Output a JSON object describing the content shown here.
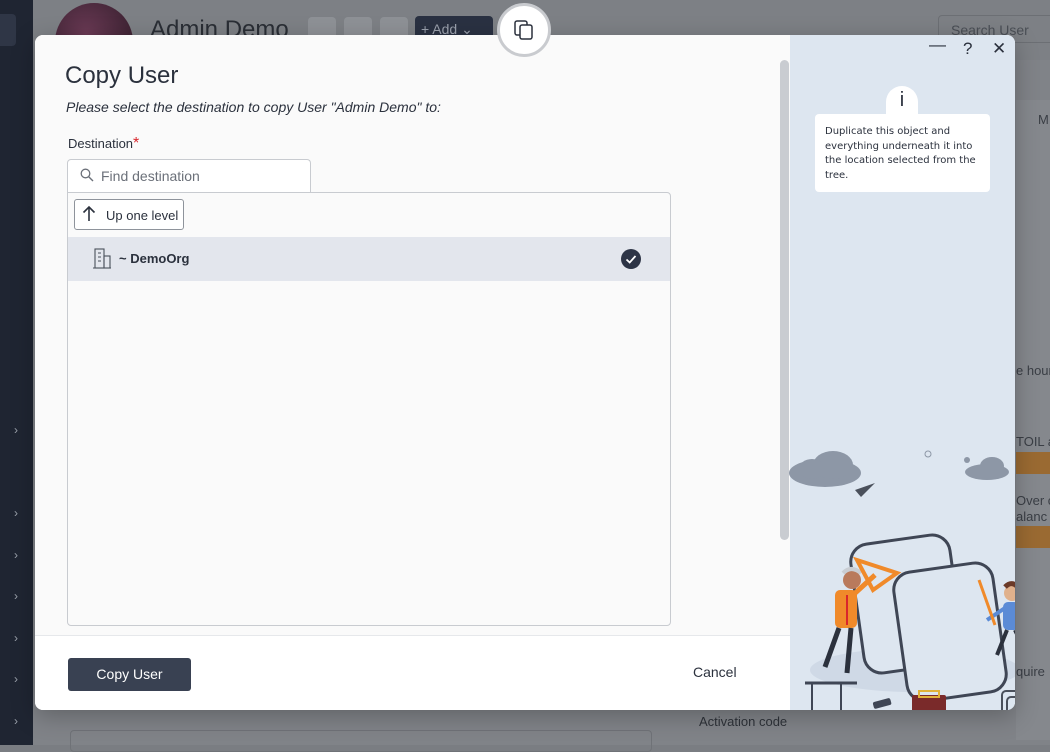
{
  "background": {
    "profile_title": "Admin Demo",
    "add_label": "+ Add ⌄",
    "search_placeholder": "Search User",
    "right_snippets": [
      "M",
      "e hour",
      "TOIL a",
      "Over c",
      "alanc",
      "quire"
    ],
    "activation_label": "Activation code"
  },
  "dialog": {
    "title": "Copy User",
    "subtitle": "Please select the destination to copy User \"Admin Demo\" to:",
    "destination_label": "Destination",
    "required_mark": "*",
    "search_placeholder": "Find destination",
    "up_button": "Up one level",
    "tree": [
      {
        "name": "~ DemoOrg",
        "selected": true,
        "icon": "building-icon"
      }
    ],
    "copy_button": "Copy User",
    "cancel_button": "Cancel"
  },
  "panel": {
    "minimize": "—",
    "help": "?",
    "close": "✕",
    "info_glyph": "i",
    "info_text": "Duplicate this object and everything underneath it into the location selected from the tree."
  },
  "colors": {
    "primary_button": "#394152",
    "selected_row": "#e3e6ed",
    "panel_bg": "#dde6f0",
    "required": "#d9262c",
    "illustration_orange": "#f08a2a"
  }
}
